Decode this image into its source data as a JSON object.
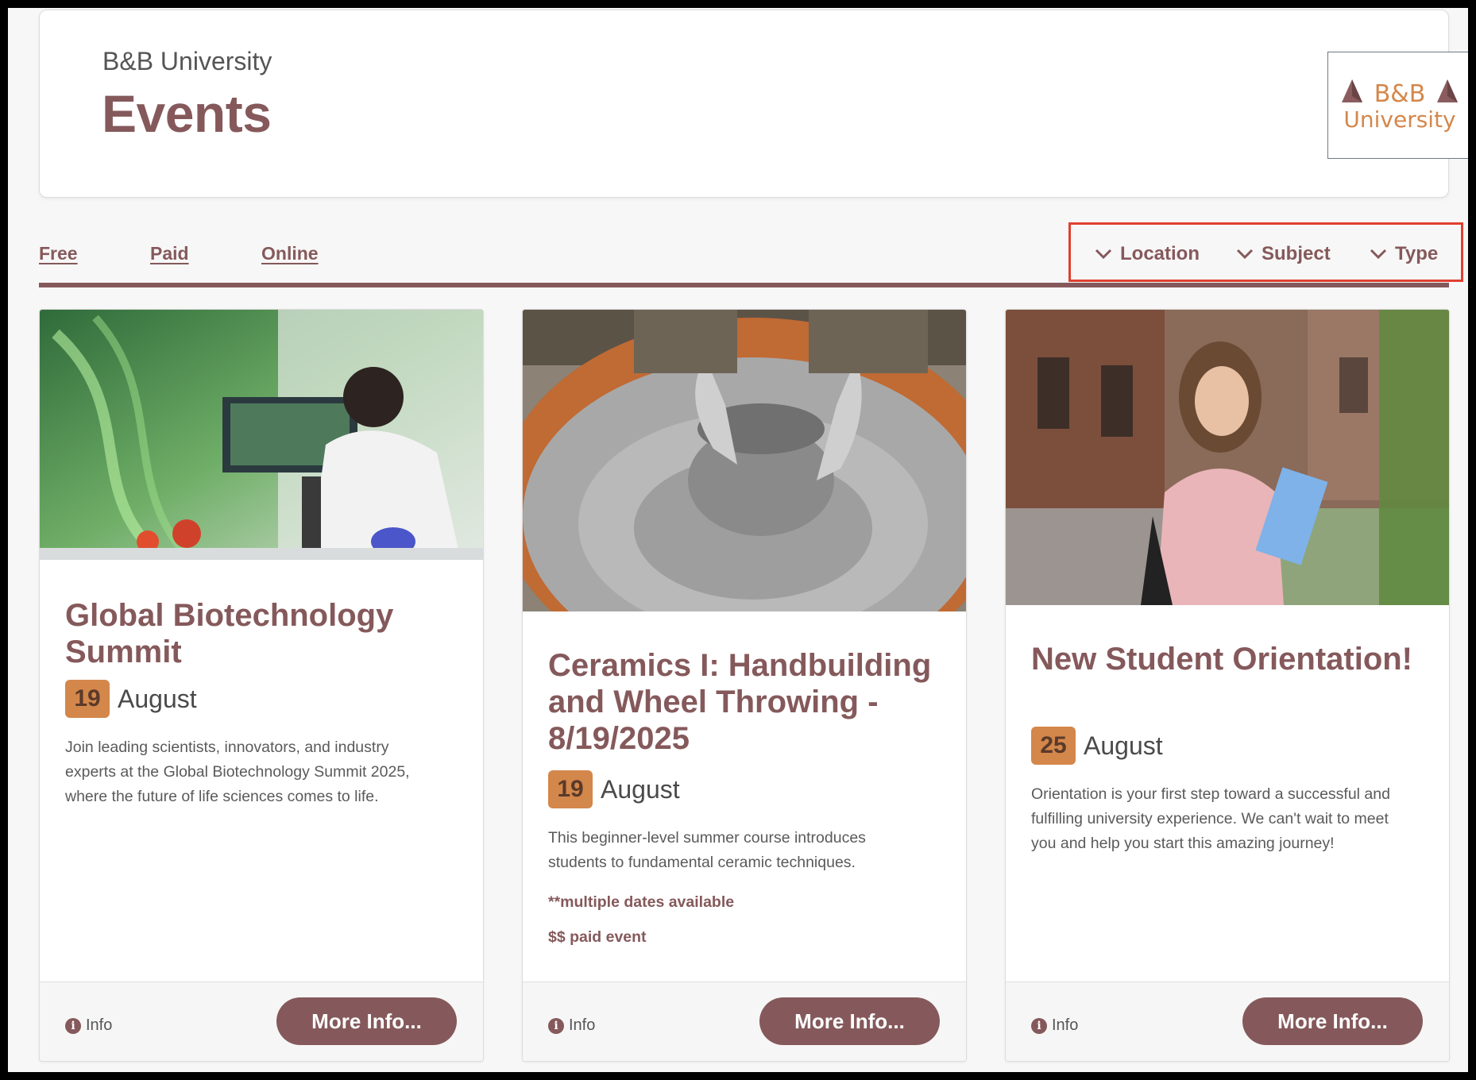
{
  "header": {
    "org_name": "B&B University",
    "title": "Events",
    "logo_text_top": "B&B",
    "logo_text_bottom": "University"
  },
  "filters": {
    "links": [
      "Free",
      "Paid",
      "Online"
    ],
    "dropdowns": [
      "Location",
      "Subject",
      "Type"
    ]
  },
  "colors": {
    "brand": "#85595b",
    "accent": "#d4874b",
    "highlight_box": "#e04030"
  },
  "events": [
    {
      "title": "Global Biotechnology Summit",
      "day": "19",
      "month": "August",
      "description": "Join leading scientists, innovators, and industry experts at the Global Biotechnology Summit 2025, where the future of life sciences comes to life.",
      "notes": [],
      "info_label": "Info",
      "button_label": "More Info..."
    },
    {
      "title": "Ceramics I: Handbuilding and Wheel Throwing - 8/19/2025",
      "day": "19",
      "month": "August",
      "description": "This beginner-level summer course introduces students to fundamental ceramic techniques.",
      "notes": [
        "**multiple dates available",
        "$$ paid event"
      ],
      "info_label": "Info",
      "button_label": "More Info..."
    },
    {
      "title": "New Student Orientation!",
      "day": "25",
      "month": "August",
      "description": "Orientation is your first step toward a successful and fulfilling university experience. We can't wait to meet you and help you start this amazing journey!",
      "notes": [],
      "info_label": "Info",
      "button_label": "More Info..."
    }
  ]
}
